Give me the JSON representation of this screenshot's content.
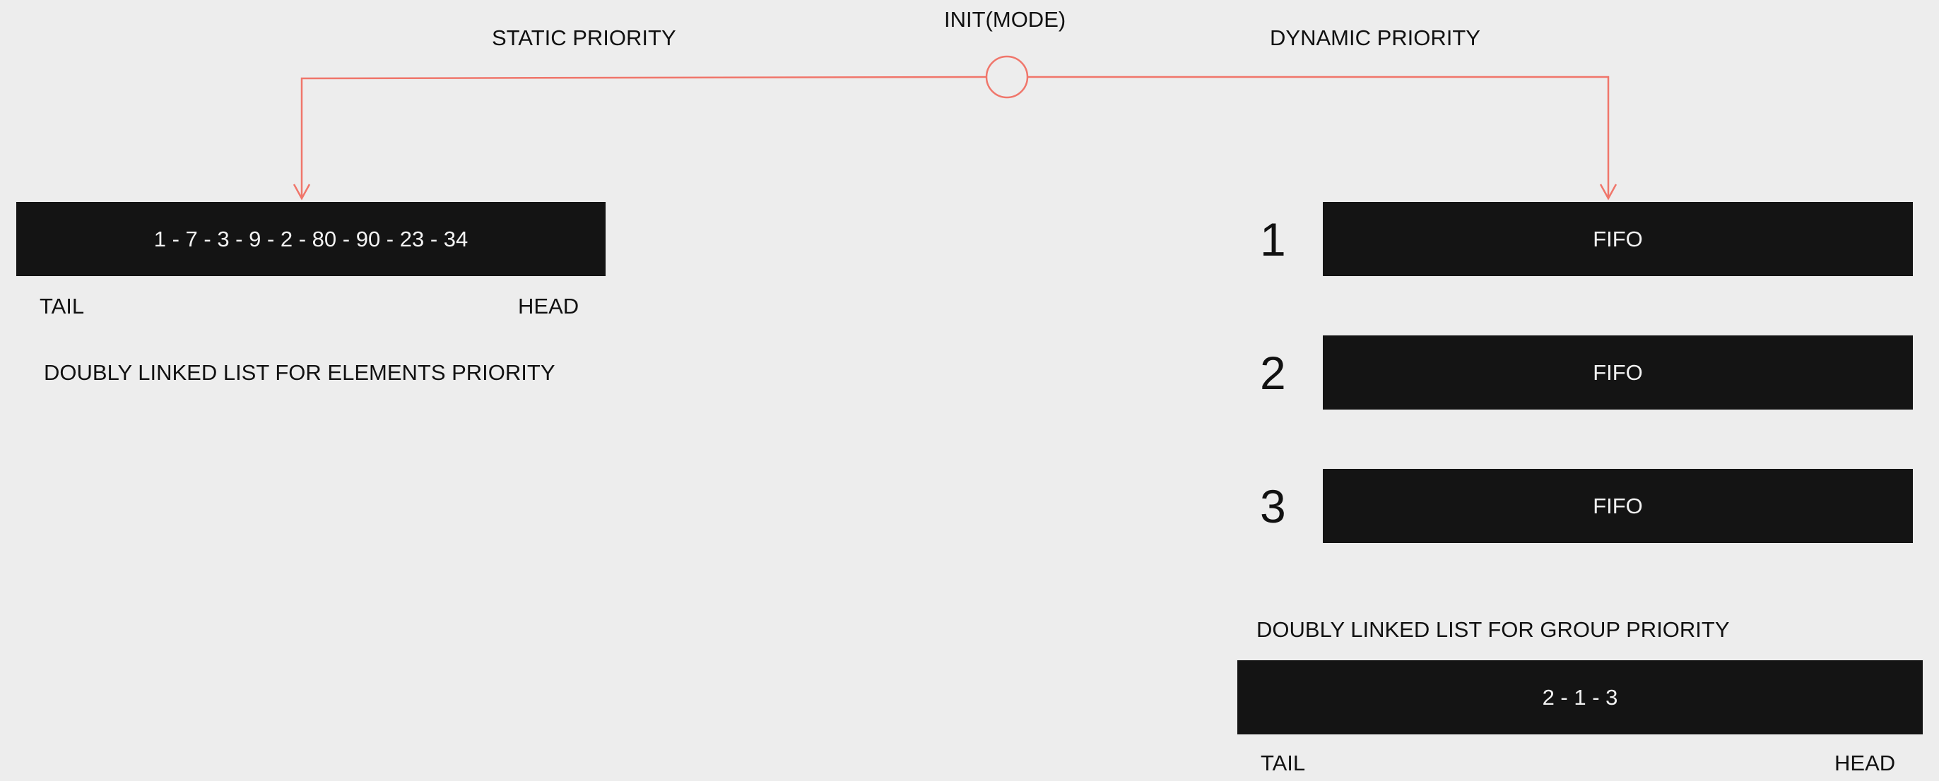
{
  "mode_node": {
    "label": "INIT(MODE)"
  },
  "branches": {
    "static_label": "STATIC PRIORITY",
    "dynamic_label": "DYNAMIC PRIORITY",
    "connector_color": "#f0766b"
  },
  "static": {
    "list_value": "1 - 7 - 3 - 9 - 2 - 80 - 90 - 23 - 34",
    "tail_label": "TAIL",
    "head_label": "HEAD",
    "caption": "DOUBLY LINKED LIST FOR ELEMENTS PRIORITY"
  },
  "dynamic": {
    "groups": [
      {
        "number": "1",
        "label": "FIFO"
      },
      {
        "number": "2",
        "label": "FIFO"
      },
      {
        "number": "3",
        "label": "FIFO"
      }
    ],
    "group_list_caption": "DOUBLY LINKED LIST FOR GROUP PRIORITY",
    "group_list_value": "2 - 1 - 3",
    "tail_label": "TAIL",
    "head_label": "HEAD"
  },
  "colors": {
    "background": "#ededed",
    "box_fill": "#141414",
    "box_text": "#f2f2f2",
    "connector": "#f0766b"
  }
}
